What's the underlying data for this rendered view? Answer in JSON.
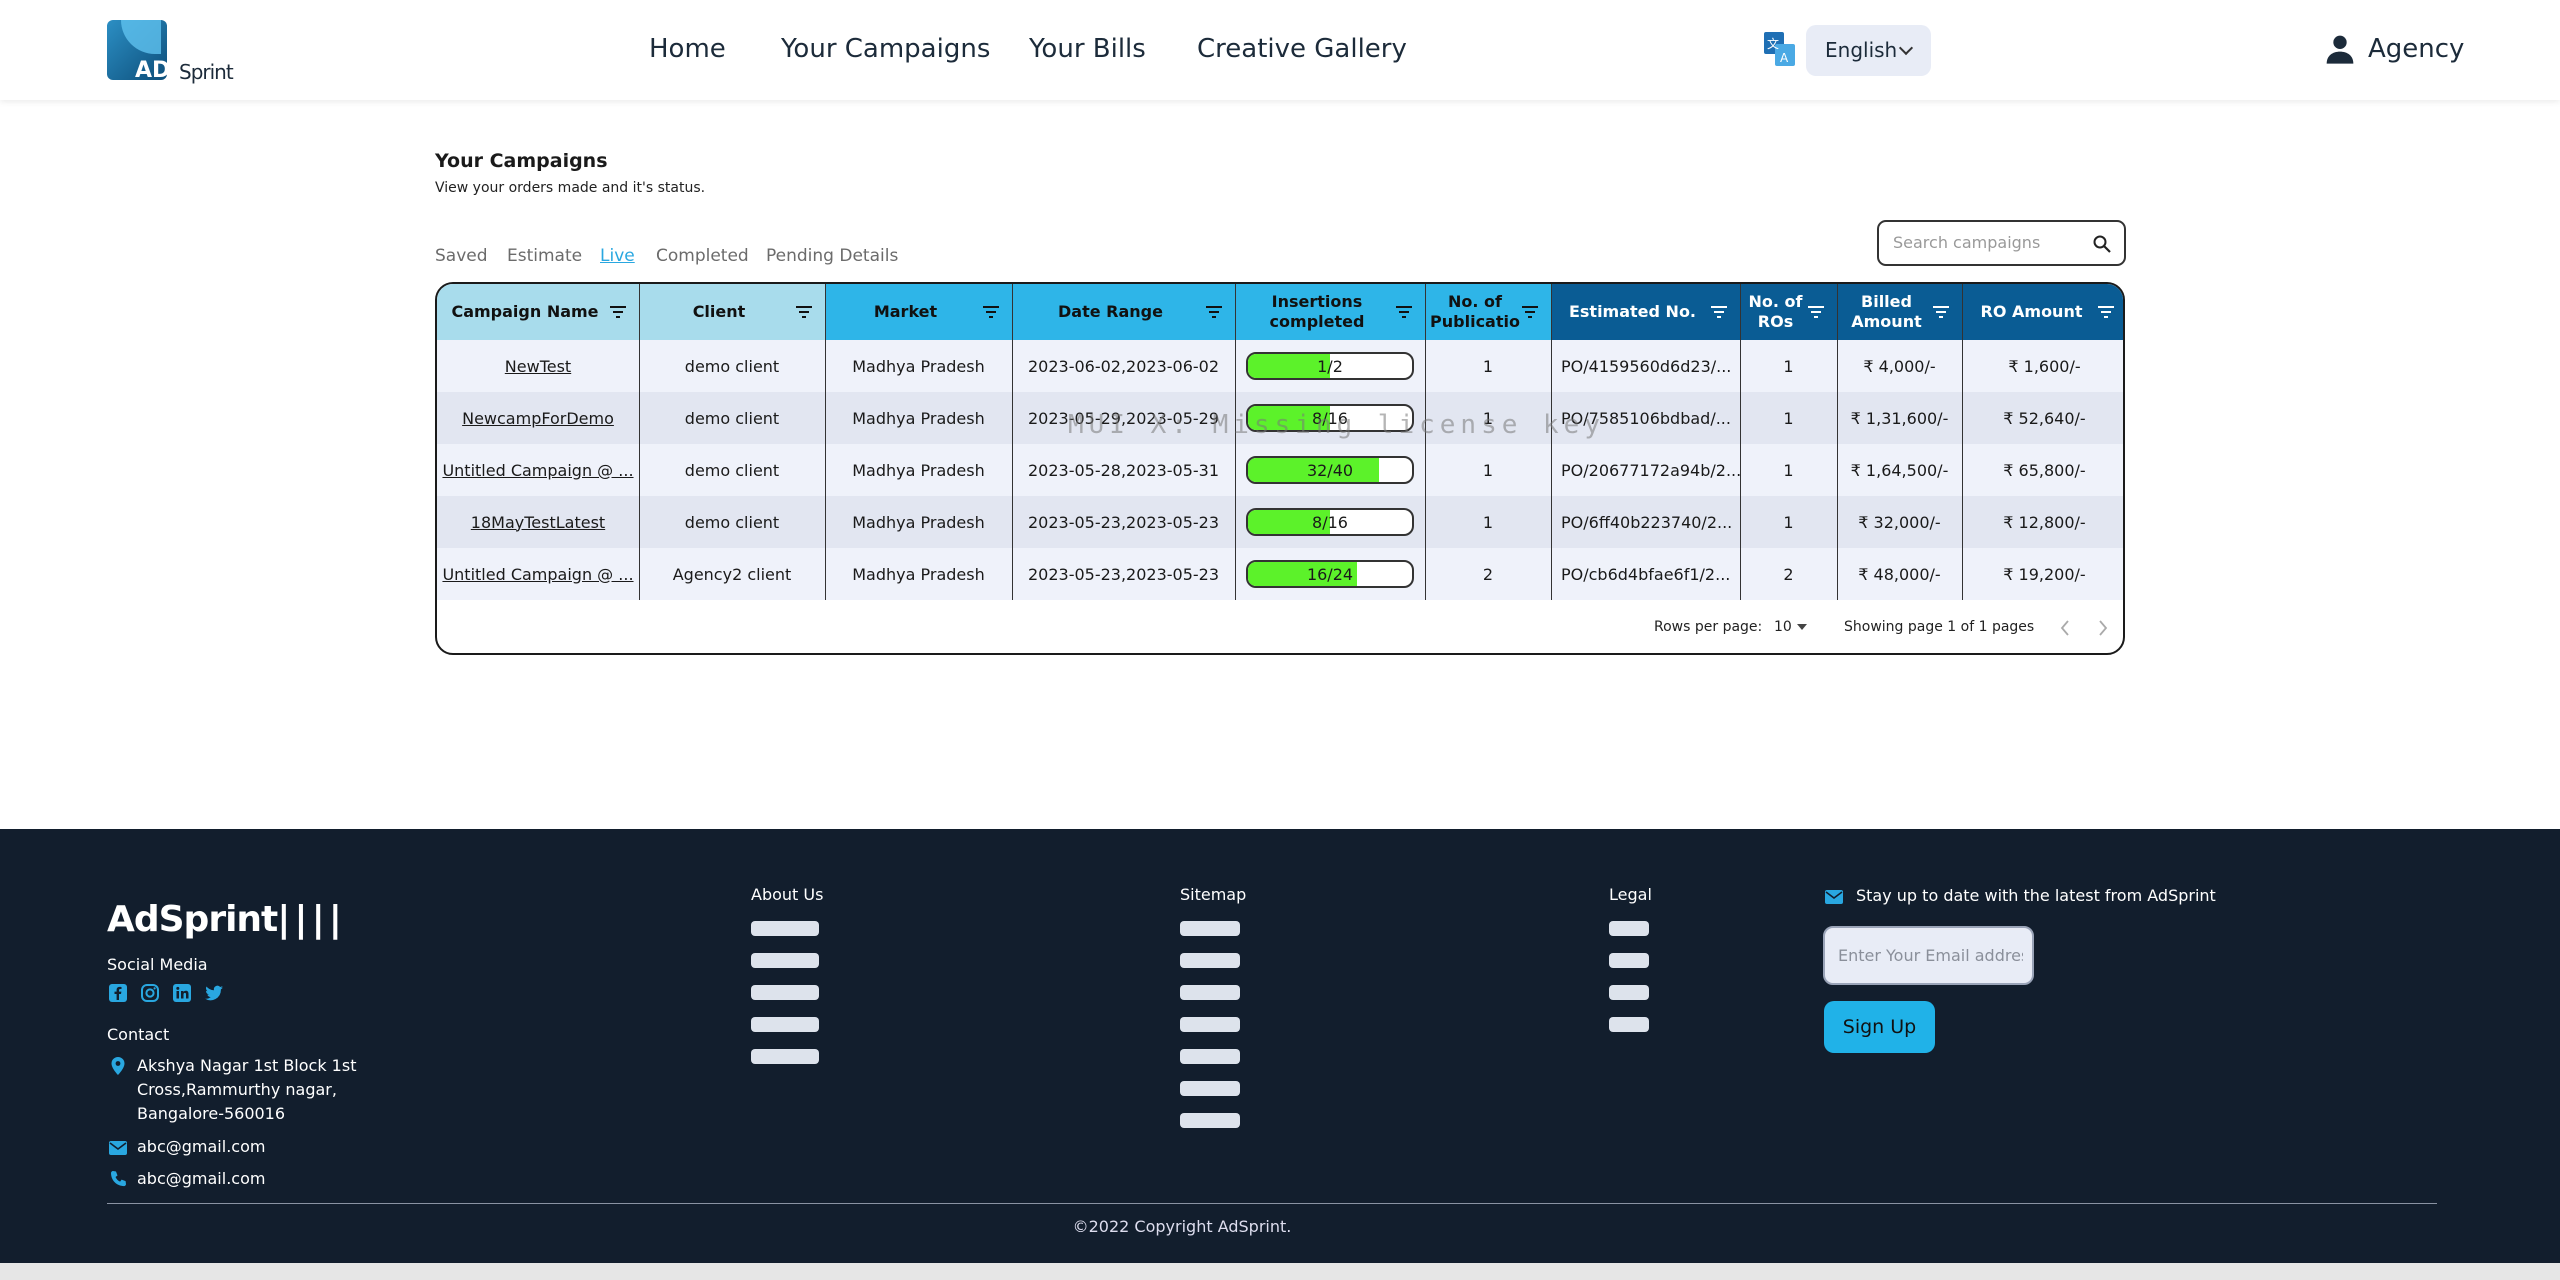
{
  "header": {
    "logo_ad": "AD",
    "logo_sprint": "Sprint",
    "nav": [
      "Home",
      "Your Campaigns",
      "Your Bills",
      "Creative Gallery"
    ],
    "language": "English",
    "user": "Agency"
  },
  "main": {
    "title": "Your Campaigns",
    "subtitle": "View your orders made and it's status.",
    "tabs": [
      "Saved",
      "Estimate",
      "Live",
      "Completed",
      "Pending Details"
    ],
    "active_tab": "Live",
    "search_placeholder": "Search campaigns",
    "watermark": "MUI X: Missing license key"
  },
  "table": {
    "headers": [
      "Campaign Name",
      "Client",
      "Market",
      "Date Range",
      "Insertions completed",
      "No. of Publicatio",
      "Estimated No.",
      "No. of ROs",
      "Billed Amount",
      "RO Amount"
    ],
    "rows": [
      [
        "NewTest",
        "demo client",
        "Madhya Pradesh",
        "2023-06-02,2023-06-02",
        "1/2",
        "1",
        "PO/4159560d6d23/...",
        "1",
        "₹ 4,000/-",
        "₹ 1,600/-"
      ],
      [
        "NewcampForDemo",
        "demo client",
        "Madhya Pradesh",
        "2023-05-29,2023-05-29",
        "8/16",
        "1",
        "PO/7585106bdbad/...",
        "1",
        "₹ 1,31,600/-",
        "₹ 52,640/-"
      ],
      [
        "Untitled Campaign @ ...",
        "demo client",
        "Madhya Pradesh",
        "2023-05-28,2023-05-31",
        "32/40",
        "1",
        "PO/20677172a94b/2...",
        "1",
        "₹ 1,64,500/-",
        "₹ 65,800/-"
      ],
      [
        "18MayTestLatest",
        "demo client",
        "Madhya Pradesh",
        "2023-05-23,2023-05-23",
        "8/16",
        "1",
        "PO/6ff40b223740/2...",
        "1",
        "₹ 32,000/-",
        "₹ 12,800/-"
      ],
      [
        "Untitled Campaign @ ...",
        "Agency2 client",
        "Madhya Pradesh",
        "2023-05-23,2023-05-23",
        "16/24",
        "2",
        "PO/cb6d4bfae6f1/2...",
        "2",
        "₹ 48,000/-",
        "₹ 19,200/-"
      ]
    ],
    "progress": [
      0.5,
      0.5,
      0.8,
      0.5,
      0.667
    ],
    "rows_per_page_label": "Rows per page:",
    "rows_per_page": "10",
    "page_info": "Showing page 1 of 1 pages"
  },
  "footer": {
    "brand": "AdSprint",
    "social_label": "Social Media",
    "social_icons": [
      "facebook-icon",
      "instagram-icon",
      "linkedin-icon",
      "twitter-icon"
    ],
    "contact_label": "Contact",
    "address": [
      "Akshya Nagar 1st Block 1st",
      "Cross,Rammurthy nagar,",
      "Bangalore-560016"
    ],
    "email": "abc@gmail.com",
    "phone": "abc@gmail.com",
    "about_title": "About Us",
    "sitemap_title": "Sitemap",
    "legal_title": "Legal",
    "newsletter_text": "Stay up to date with the latest from AdSprint",
    "email_placeholder": "Enter Your Email address",
    "signup_label": "Sign Up",
    "copyright": "©2022 Copyright AdSprint."
  },
  "colors": {
    "header_light": "#a8dcec",
    "header_mid": "#2eb5e8",
    "header_dark": "#0a5c94",
    "progress_fill": "#5cf22a",
    "footer_bg": "#121e2d",
    "accent": "#29a7e0"
  }
}
